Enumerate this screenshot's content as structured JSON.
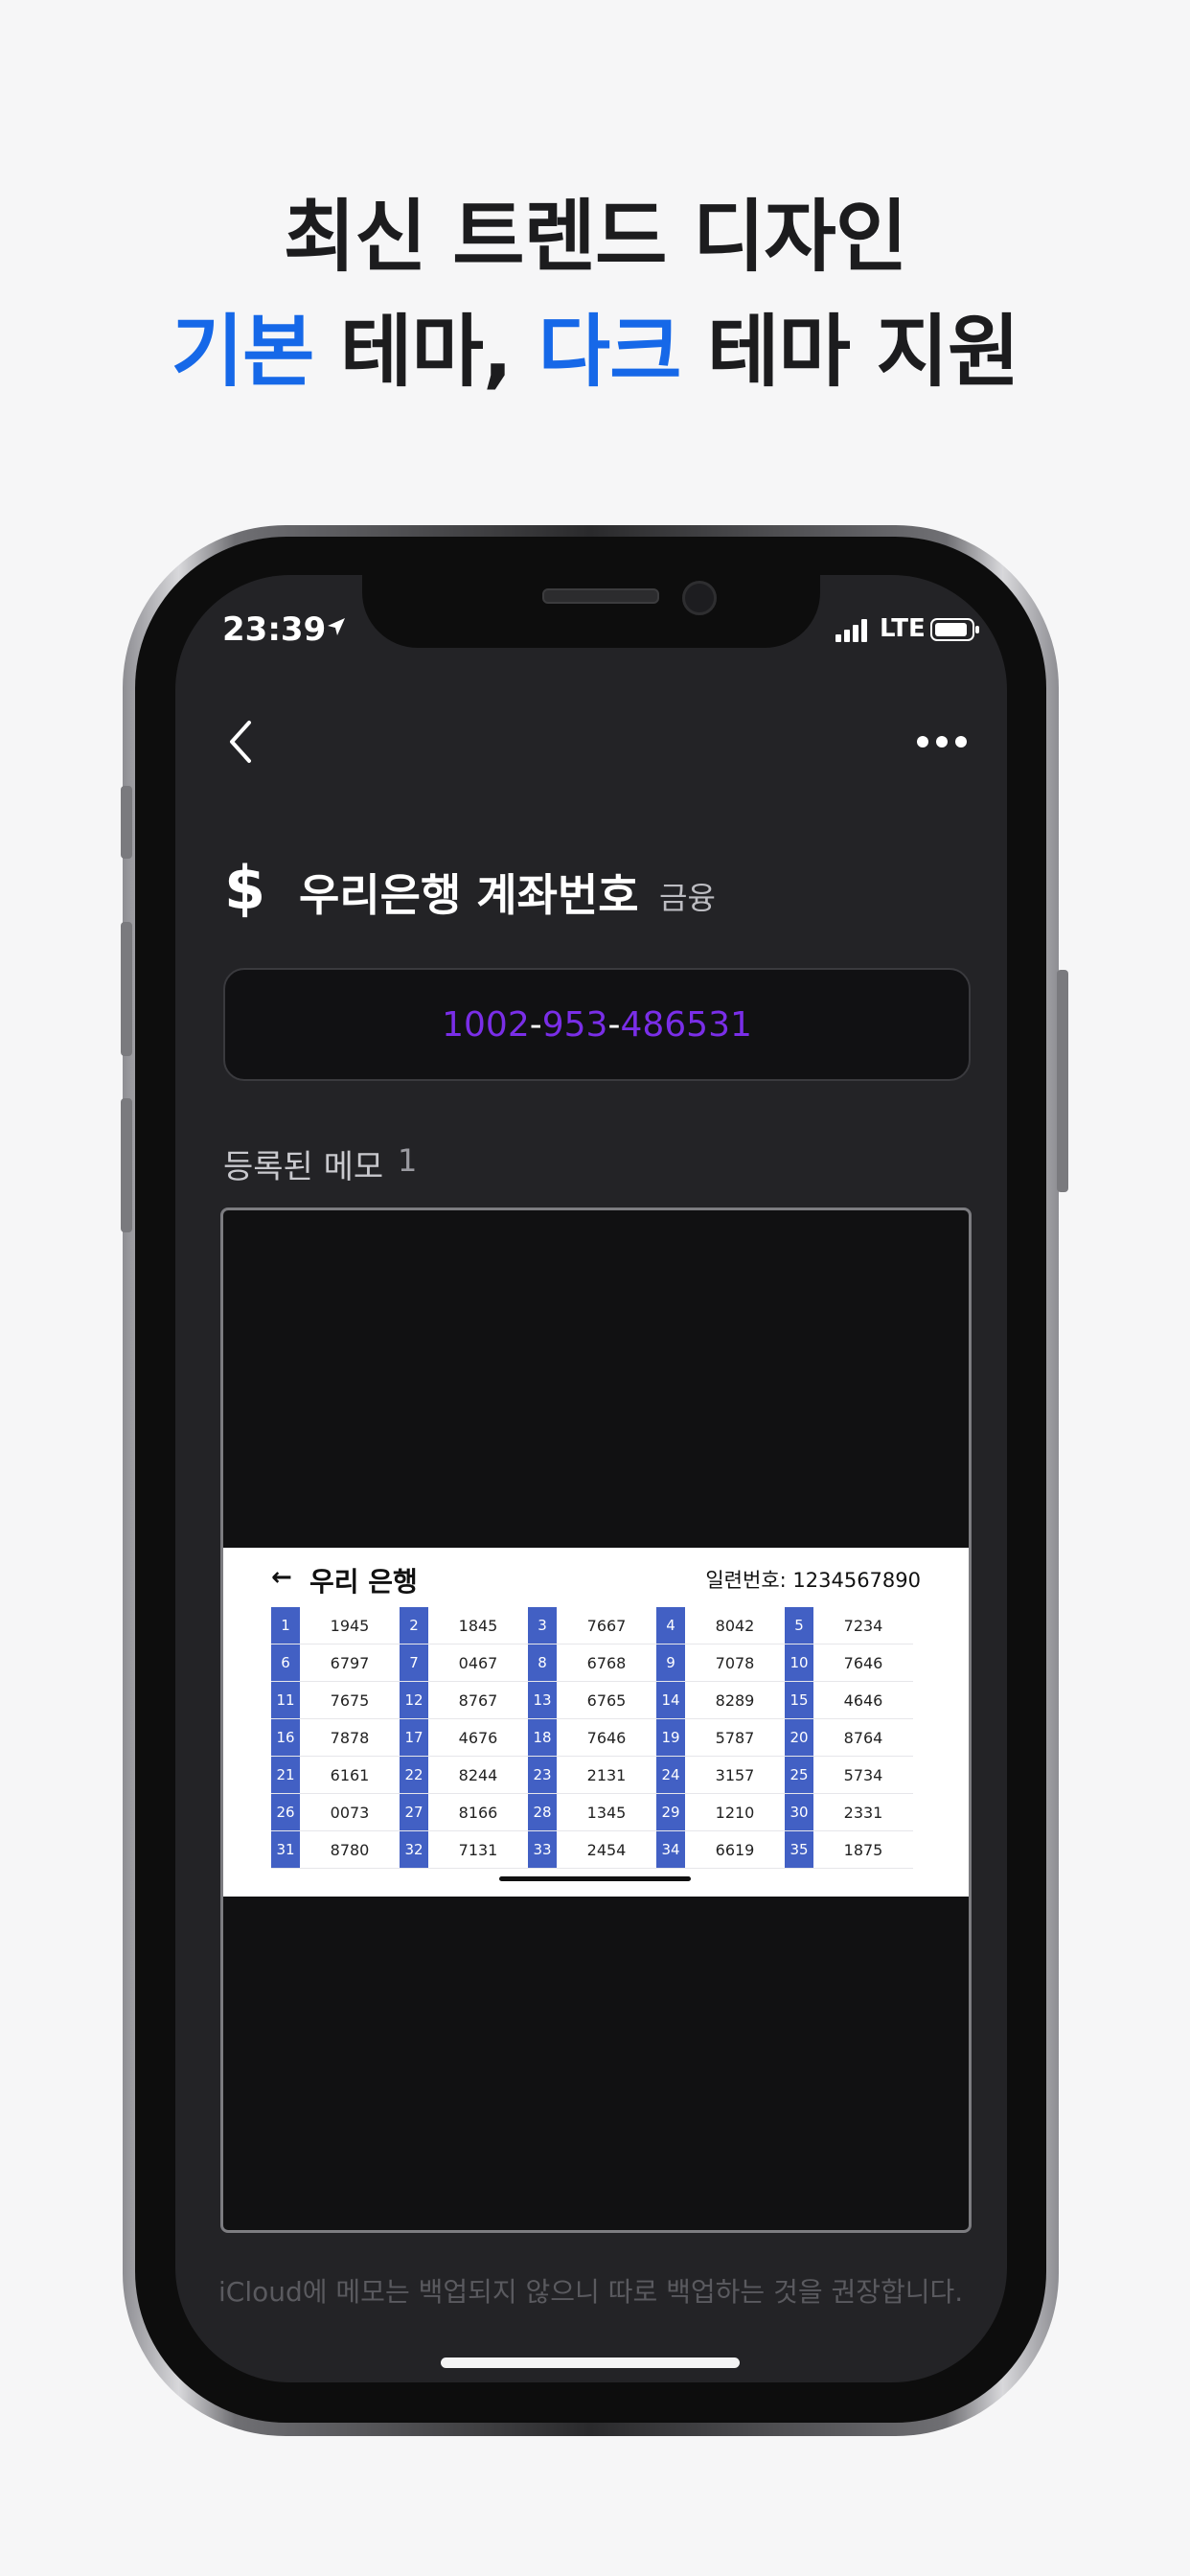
{
  "headline": {
    "line1": "최신 트렌드 디자인",
    "line2_part1": "기본",
    "line2_part2": " 테마, ",
    "line2_part3": "다크",
    "line2_part4": " 테마 지원"
  },
  "status_bar": {
    "time": "23:39",
    "network": "LTE"
  },
  "item": {
    "title": "우리은행 계좌번호",
    "category": "금융",
    "account": {
      "part1": "1002",
      "part2": "953",
      "part3": "486531",
      "separator": "-"
    }
  },
  "memo": {
    "label": "등록된 메모",
    "count": "1"
  },
  "card": {
    "back": "←",
    "title": "우리 은행",
    "serial": "일련번호: 1234567890",
    "rows": [
      [
        [
          "1",
          "1945"
        ],
        [
          "2",
          "1845"
        ],
        [
          "3",
          "7667"
        ],
        [
          "4",
          "8042"
        ],
        [
          "5",
          "7234"
        ]
      ],
      [
        [
          "6",
          "6797"
        ],
        [
          "7",
          "0467"
        ],
        [
          "8",
          "6768"
        ],
        [
          "9",
          "7078"
        ],
        [
          "10",
          "7646"
        ]
      ],
      [
        [
          "11",
          "7675"
        ],
        [
          "12",
          "8767"
        ],
        [
          "13",
          "6765"
        ],
        [
          "14",
          "8289"
        ],
        [
          "15",
          "4646"
        ]
      ],
      [
        [
          "16",
          "7878"
        ],
        [
          "17",
          "4676"
        ],
        [
          "18",
          "7646"
        ],
        [
          "19",
          "5787"
        ],
        [
          "20",
          "8764"
        ]
      ],
      [
        [
          "21",
          "6161"
        ],
        [
          "22",
          "8244"
        ],
        [
          "23",
          "2131"
        ],
        [
          "24",
          "3157"
        ],
        [
          "25",
          "5734"
        ]
      ],
      [
        [
          "26",
          "0073"
        ],
        [
          "27",
          "8166"
        ],
        [
          "28",
          "1345"
        ],
        [
          "29",
          "1210"
        ],
        [
          "30",
          "2331"
        ]
      ],
      [
        [
          "31",
          "8780"
        ],
        [
          "32",
          "7131"
        ],
        [
          "33",
          "2454"
        ],
        [
          "34",
          "6619"
        ],
        [
          "35",
          "1875"
        ]
      ]
    ]
  },
  "footer_note": "iCloud에 메모는 백업되지 않으니 따로 백업하는 것을 권장합니다.",
  "icons": {
    "back": "chevron-left-icon",
    "more": "more-horizontal-icon",
    "dollar": "$"
  },
  "colors": {
    "accent_blue": "#1668e8",
    "account_purple": "#7a2ee8",
    "grid_index": "#4260c4"
  }
}
